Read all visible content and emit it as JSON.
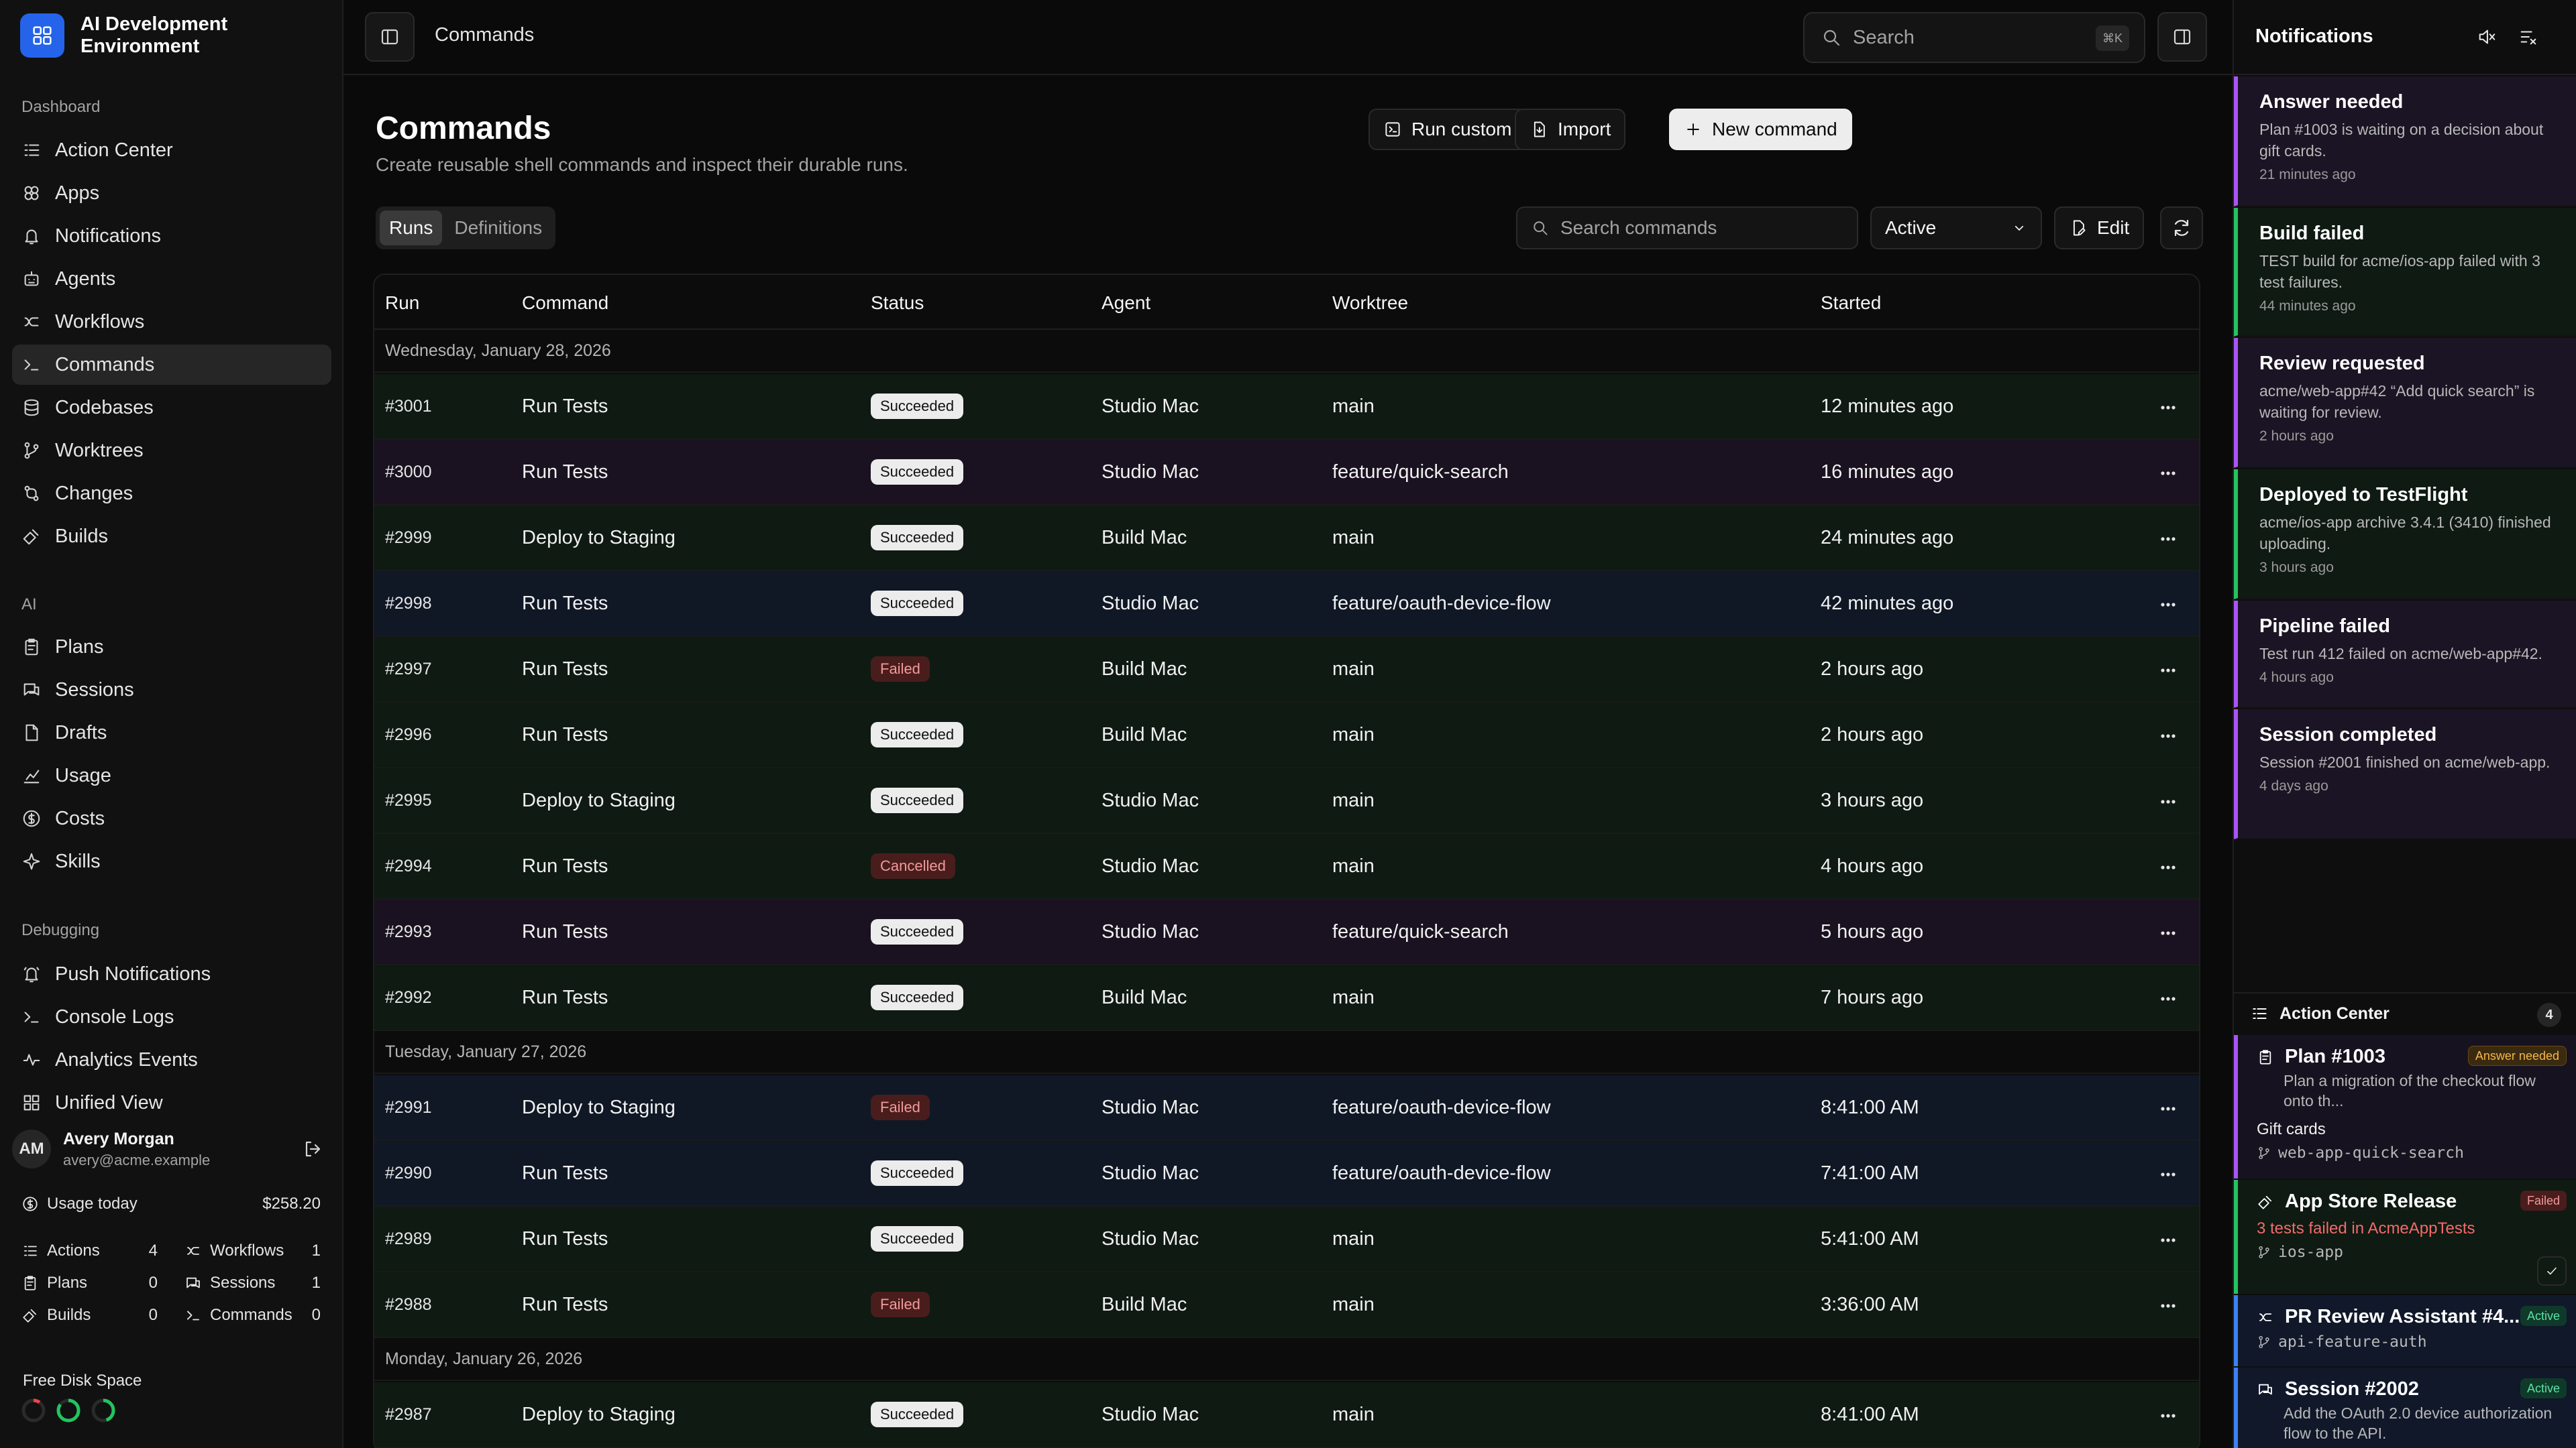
{
  "app": {
    "title": "AI Development Environment"
  },
  "sidebar": {
    "sections": [
      {
        "label": "Dashboard",
        "items": [
          {
            "label": "Action Center",
            "icon": "list-icon"
          },
          {
            "label": "Apps",
            "icon": "apps-icon"
          },
          {
            "label": "Notifications",
            "icon": "bell-icon"
          },
          {
            "label": "Agents",
            "icon": "bot-icon"
          },
          {
            "label": "Workflows",
            "icon": "workflow-icon"
          },
          {
            "label": "Commands",
            "icon": "terminal-icon",
            "active": true
          },
          {
            "label": "Codebases",
            "icon": "database-icon"
          },
          {
            "label": "Worktrees",
            "icon": "branch-icon"
          },
          {
            "label": "Changes",
            "icon": "diff-icon"
          },
          {
            "label": "Builds",
            "icon": "hammer-icon"
          }
        ]
      },
      {
        "label": "AI",
        "items": [
          {
            "label": "Plans",
            "icon": "clipboard-icon"
          },
          {
            "label": "Sessions",
            "icon": "chat-icon"
          },
          {
            "label": "Drafts",
            "icon": "file-icon"
          },
          {
            "label": "Usage",
            "icon": "chart-icon"
          },
          {
            "label": "Costs",
            "icon": "dollar-icon"
          },
          {
            "label": "Skills",
            "icon": "sparkle-icon"
          }
        ]
      },
      {
        "label": "Debugging",
        "items": [
          {
            "label": "Push Notifications",
            "icon": "bell-ring-icon"
          },
          {
            "label": "Console Logs",
            "icon": "terminal-icon"
          },
          {
            "label": "Analytics Events",
            "icon": "activity-icon"
          },
          {
            "label": "Unified View",
            "icon": "grid-icon"
          }
        ]
      }
    ],
    "user": {
      "initials": "AM",
      "name": "Avery Morgan",
      "email": "avery@acme.example"
    },
    "usage": {
      "label": "Usage today",
      "value": "$258.20"
    },
    "stats": [
      {
        "label": "Actions",
        "value": "4"
      },
      {
        "label": "Workflows",
        "value": "1"
      },
      {
        "label": "Plans",
        "value": "0"
      },
      {
        "label": "Sessions",
        "value": "1"
      },
      {
        "label": "Builds",
        "value": "0"
      },
      {
        "label": "Commands",
        "value": "0"
      }
    ],
    "disk": {
      "label": "Free Disk Space",
      "rings": [
        {
          "color": "#ef4444",
          "fraction": 0.1
        },
        {
          "color": "#22c55e",
          "fraction": 0.85
        },
        {
          "color": "#22c55e",
          "fraction": 0.45
        }
      ]
    }
  },
  "topbar": {
    "breadcrumb": "Commands",
    "search_placeholder": "Search",
    "shortcut": "⌘K"
  },
  "page": {
    "title": "Commands",
    "subtitle": "Create reusable shell commands and inspect their durable runs.",
    "buttons": {
      "run_custom": "Run custom",
      "import": "Import",
      "new_command": "New command"
    },
    "tabs": [
      "Runs",
      "Definitions"
    ],
    "search_placeholder": "Search commands",
    "filter": "Active",
    "edit": "Edit"
  },
  "table": {
    "columns": [
      "Run",
      "Command",
      "Status",
      "Agent",
      "Worktree",
      "Started"
    ],
    "groups": [
      {
        "date": "Wednesday, January 28, 2026",
        "rows": [
          {
            "run": "#3001",
            "command": "Run Tests",
            "status": "Succeeded",
            "agent": "Studio Mac",
            "worktree": "main",
            "started": "12 minutes ago",
            "tint": "#0f1a12"
          },
          {
            "run": "#3000",
            "command": "Run Tests",
            "status": "Succeeded",
            "agent": "Studio Mac",
            "worktree": "feature/quick-search",
            "started": "16 minutes ago",
            "tint": "#1a1220"
          },
          {
            "run": "#2999",
            "command": "Deploy to Staging",
            "status": "Succeeded",
            "agent": "Build Mac",
            "worktree": "main",
            "started": "24 minutes ago",
            "tint": "#0f1a12"
          },
          {
            "run": "#2998",
            "command": "Run Tests",
            "status": "Succeeded",
            "agent": "Studio Mac",
            "worktree": "feature/oauth-device-flow",
            "started": "42 minutes ago",
            "tint": "#101826"
          },
          {
            "run": "#2997",
            "command": "Run Tests",
            "status": "Failed",
            "agent": "Build Mac",
            "worktree": "main",
            "started": "2 hours ago",
            "tint": "#0f1a12"
          },
          {
            "run": "#2996",
            "command": "Run Tests",
            "status": "Succeeded",
            "agent": "Build Mac",
            "worktree": "main",
            "started": "2 hours ago",
            "tint": "#0f1a12"
          },
          {
            "run": "#2995",
            "command": "Deploy to Staging",
            "status": "Succeeded",
            "agent": "Studio Mac",
            "worktree": "main",
            "started": "3 hours ago",
            "tint": "#0f1a12"
          },
          {
            "run": "#2994",
            "command": "Run Tests",
            "status": "Cancelled",
            "agent": "Studio Mac",
            "worktree": "main",
            "started": "4 hours ago",
            "tint": "#0f1a12"
          },
          {
            "run": "#2993",
            "command": "Run Tests",
            "status": "Succeeded",
            "agent": "Studio Mac",
            "worktree": "feature/quick-search",
            "started": "5 hours ago",
            "tint": "#1a1220"
          },
          {
            "run": "#2992",
            "command": "Run Tests",
            "status": "Succeeded",
            "agent": "Build Mac",
            "worktree": "main",
            "started": "7 hours ago",
            "tint": "#0f1a12"
          }
        ]
      },
      {
        "date": "Tuesday, January 27, 2026",
        "rows": [
          {
            "run": "#2991",
            "command": "Deploy to Staging",
            "status": "Failed",
            "agent": "Studio Mac",
            "worktree": "feature/oauth-device-flow",
            "started": "8:41:00 AM",
            "tint": "#101826"
          },
          {
            "run": "#2990",
            "command": "Run Tests",
            "status": "Succeeded",
            "agent": "Studio Mac",
            "worktree": "feature/oauth-device-flow",
            "started": "7:41:00 AM",
            "tint": "#101826"
          },
          {
            "run": "#2989",
            "command": "Run Tests",
            "status": "Succeeded",
            "agent": "Studio Mac",
            "worktree": "main",
            "started": "5:41:00 AM",
            "tint": "#0f1a12"
          },
          {
            "run": "#2988",
            "command": "Run Tests",
            "status": "Failed",
            "agent": "Build Mac",
            "worktree": "main",
            "started": "3:36:00 AM",
            "tint": "#0f1a12"
          }
        ]
      },
      {
        "date": "Monday, January 26, 2026",
        "rows": [
          {
            "run": "#2987",
            "command": "Deploy to Staging",
            "status": "Succeeded",
            "agent": "Studio Mac",
            "worktree": "main",
            "started": "8:41:00 AM",
            "tint": "#0f1a12"
          }
        ]
      }
    ]
  },
  "notifications": {
    "title": "Notifications",
    "items": [
      {
        "title": "Answer needed",
        "body": "Plan #1003 is waiting on a decision about gift cards.",
        "age": "21 minutes ago",
        "color": "#a855f7",
        "bg": "#1b1424"
      },
      {
        "title": "Build failed",
        "body": "TEST build for acme/ios-app failed with 3 test failures.",
        "age": "44 minutes ago",
        "color": "#22c55e",
        "bg": "#0f1a12"
      },
      {
        "title": "Review requested",
        "body": "acme/web-app#42 “Add quick search” is waiting for review.",
        "age": "2 hours ago",
        "color": "#a855f7",
        "bg": "#1b1424"
      },
      {
        "title": "Deployed to TestFlight",
        "body": "acme/ios-app archive 3.4.1 (3410) finished uploading.",
        "age": "3 hours ago",
        "color": "#22c55e",
        "bg": "#0f1a12"
      },
      {
        "title": "Pipeline failed",
        "body": "Test run 412 failed on acme/web-app#42.",
        "age": "4 hours ago",
        "color": "#a855f7",
        "bg": "#1b1424"
      },
      {
        "title": "Session completed",
        "body": "Session #2001 finished on acme/web-app.",
        "age": "4 days ago",
        "color": "#a855f7",
        "bg": "#1b1424"
      }
    ]
  },
  "action_center": {
    "title": "Action Center",
    "count": "4",
    "items": [
      {
        "title": "Plan #1003",
        "tag": "Answer needed",
        "desc": "Plan a migration of the checkout flow onto th...",
        "sub": "Gift cards",
        "branch": "web-app-quick-search"
      },
      {
        "title": "App Store Release",
        "tag": "Failed",
        "error": "3 tests failed in AcmeAppTests",
        "branch": "ios-app"
      },
      {
        "title": "PR Review Assistant #4...",
        "tag": "Active",
        "branch": "api-feature-auth"
      },
      {
        "title": "Session #2002",
        "tag": "Active",
        "desc": "Add the OAuth 2.0 device authorization flow to the API."
      }
    ]
  }
}
